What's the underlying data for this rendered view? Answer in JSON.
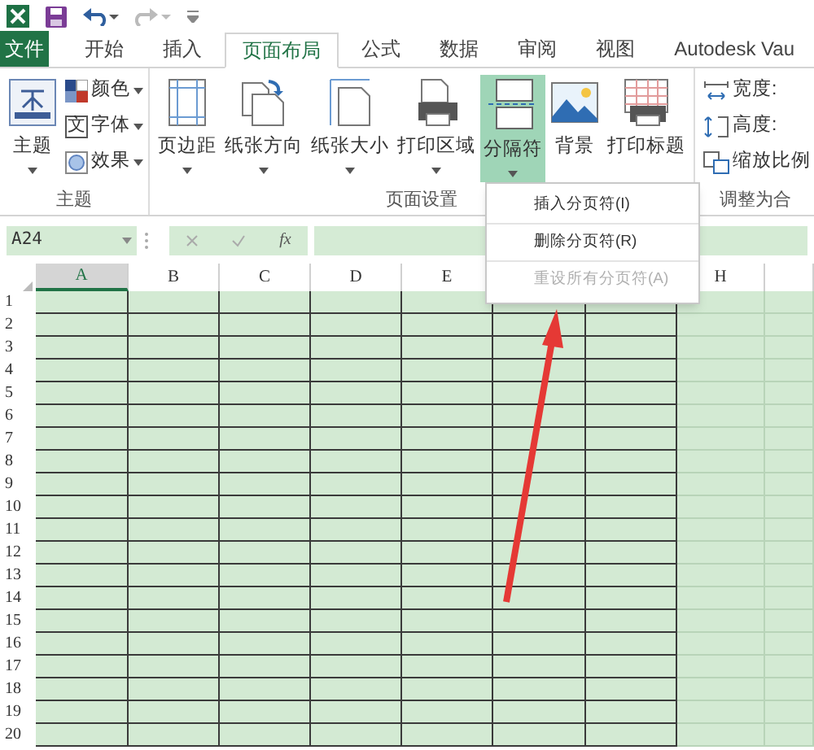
{
  "tabs": [
    {
      "label": "文件",
      "kind": "file",
      "selected": false
    },
    {
      "label": "开始",
      "kind": "tab",
      "selected": false
    },
    {
      "label": "插入",
      "kind": "tab",
      "selected": false
    },
    {
      "label": "页面布局",
      "kind": "tab",
      "selected": true
    },
    {
      "label": "公式",
      "kind": "tab",
      "selected": false
    },
    {
      "label": "数据",
      "kind": "tab",
      "selected": false
    },
    {
      "label": "审阅",
      "kind": "tab",
      "selected": false
    },
    {
      "label": "视图",
      "kind": "tab",
      "selected": false
    },
    {
      "label": "Autodesk Vau",
      "kind": "tab",
      "selected": false
    }
  ],
  "ribbon": {
    "groups": [
      {
        "label": "主题",
        "large": [
          {
            "label": "主题",
            "dropdown": true,
            "pressed": false
          }
        ],
        "small": [
          {
            "label": "颜色",
            "dropdown": true
          },
          {
            "label": "字体",
            "dropdown": true,
            "glyph": "文"
          },
          {
            "label": "效果",
            "dropdown": true
          }
        ]
      },
      {
        "label": "页面设置",
        "large": [
          {
            "label": "页边距",
            "dropdown": true,
            "pressed": false
          },
          {
            "label": "纸张方向",
            "dropdown": true,
            "pressed": false
          },
          {
            "label": "纸张大小",
            "dropdown": true,
            "pressed": false
          },
          {
            "label": "打印区域",
            "dropdown": true,
            "pressed": false
          },
          {
            "label": "分隔符",
            "dropdown": true,
            "pressed": true
          },
          {
            "label": "背景",
            "dropdown": false,
            "pressed": false
          },
          {
            "label": "打印标题",
            "dropdown": false,
            "pressed": false
          }
        ]
      },
      {
        "label": "调整为合",
        "small": [
          {
            "label": "宽度:",
            "dropdown": false
          },
          {
            "label": "高度:",
            "dropdown": false
          },
          {
            "label": "缩放比例",
            "dropdown": false
          }
        ]
      }
    ]
  },
  "formula_bar": {
    "name_box": "A24",
    "function_label": "fx"
  },
  "sheet": {
    "columns": [
      {
        "label": "A",
        "selected": true
      },
      {
        "label": "B",
        "selected": false
      },
      {
        "label": "C",
        "selected": false
      },
      {
        "label": "D",
        "selected": false
      },
      {
        "label": "E",
        "selected": false
      },
      {
        "label": "H",
        "selected": false
      }
    ],
    "rows": [
      "1",
      "2",
      "3",
      "4",
      "5",
      "6",
      "7",
      "8",
      "9",
      "10",
      "11",
      "12",
      "13",
      "14",
      "15",
      "16",
      "17",
      "18",
      "19",
      "20"
    ]
  },
  "menu": {
    "items": [
      {
        "label": "插入分页符(I)",
        "disabled": false
      },
      {
        "label": "删除分页符(R)",
        "disabled": false
      },
      {
        "label": "重设所有分页符(A)",
        "disabled": true
      }
    ]
  },
  "annotations": [
    {
      "kind": "arrow"
    }
  ]
}
